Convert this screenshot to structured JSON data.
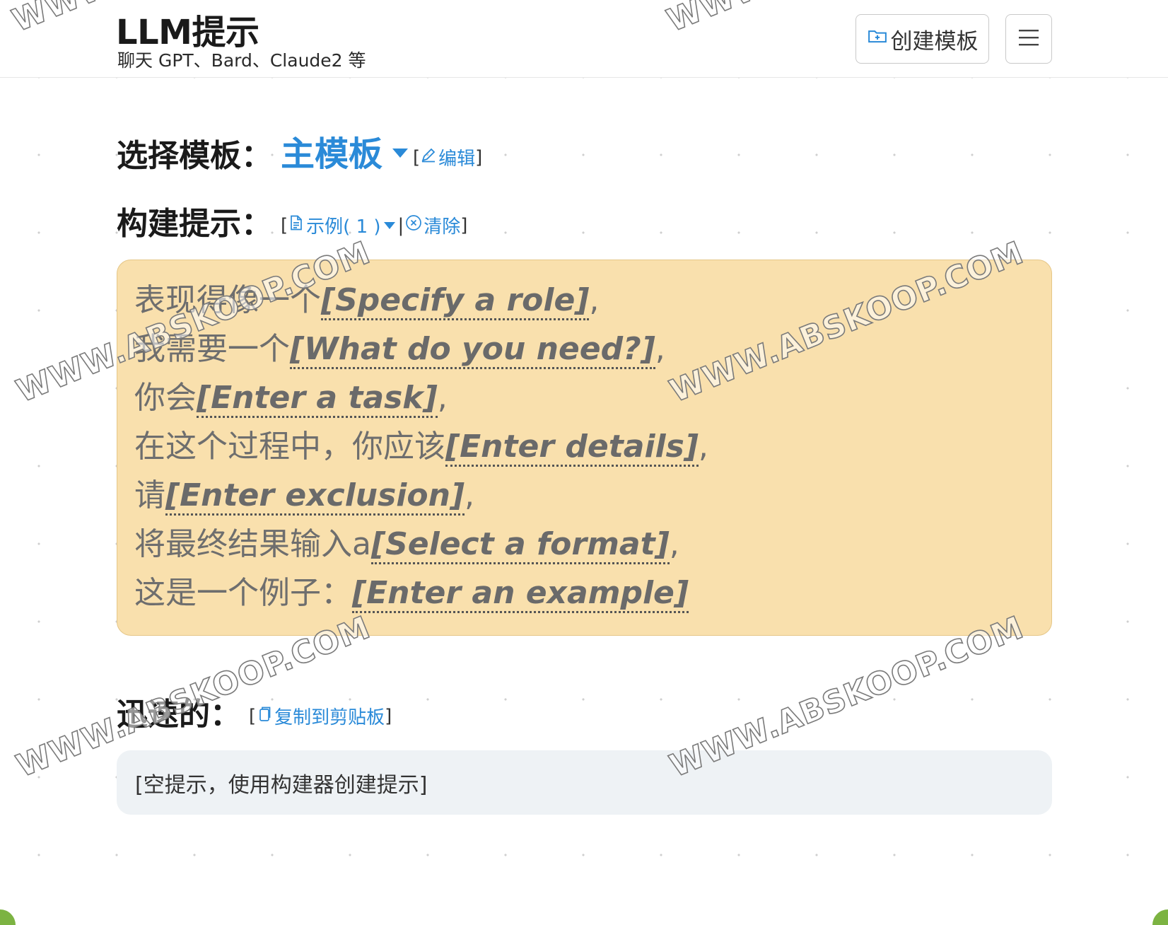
{
  "header": {
    "title": "LLM提示",
    "subtitle": "聊天 GPT、Bard、Claude2 等",
    "create_template_label": "创建模板"
  },
  "template_select": {
    "label": "选择模板：",
    "current": "主模板",
    "edit_label": "编辑"
  },
  "builder": {
    "label": "构建提示：",
    "example_label": "示例( 1 )",
    "clear_label": "清除",
    "lines": [
      {
        "prefix": "表现得像一个",
        "placeholder": "[Specify a role]",
        "suffix": ","
      },
      {
        "prefix": "我需要一个",
        "placeholder": "[What do you need?]",
        "suffix": ","
      },
      {
        "prefix": "你会",
        "placeholder": "[Enter a task]",
        "suffix": ","
      },
      {
        "prefix": "在这个过程中，你应该",
        "placeholder": "[Enter details]",
        "suffix": ","
      },
      {
        "prefix": "请",
        "placeholder": "[Enter exclusion]",
        "suffix": ","
      },
      {
        "prefix": "将最终结果输入a",
        "placeholder": "[Select a format]",
        "suffix": ","
      },
      {
        "prefix": "这是一个例子：",
        "placeholder": "[Enter an example]",
        "suffix": ""
      }
    ]
  },
  "quick": {
    "label": "迅速的：",
    "copy_label": "复制到剪贴板",
    "output": "[空提示，使用构建器创建提示]"
  },
  "watermark": "WWW.ABSKOOP.COM",
  "colors": {
    "accent": "#2a8ad8",
    "builder_bg": "#f9e0ad",
    "output_bg": "#eef2f5"
  }
}
